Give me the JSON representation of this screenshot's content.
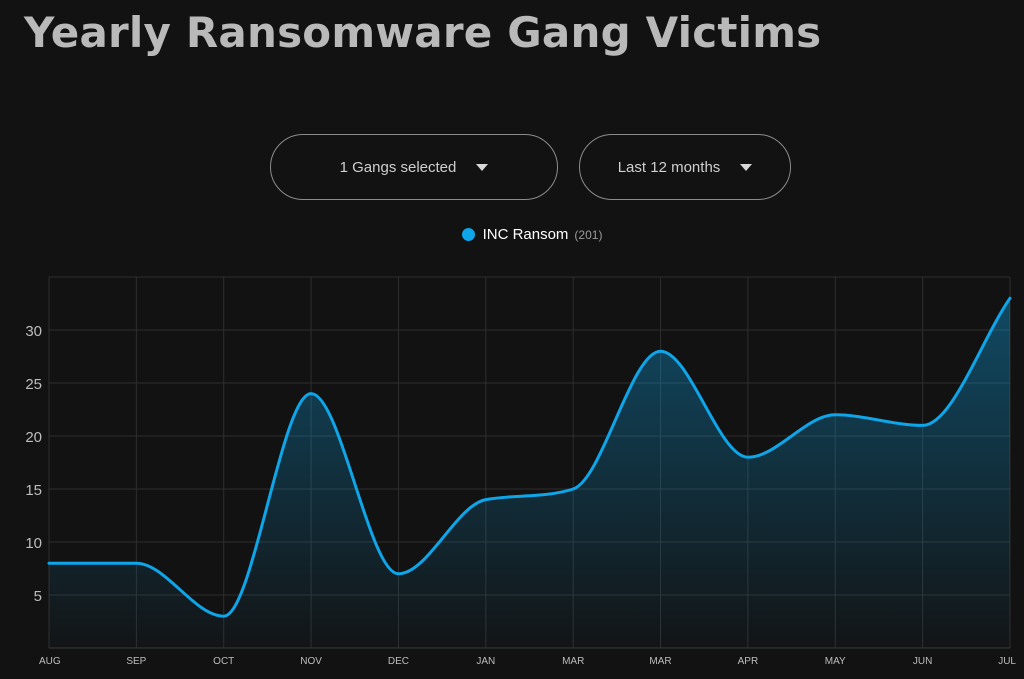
{
  "page": {
    "title": "Yearly Ransomware Gang Victims"
  },
  "filters": {
    "gangs_label": "1 Gangs selected",
    "range_label": "Last 12 months"
  },
  "colors": {
    "series": "#0ea5e9",
    "background": "#121212",
    "grid": "#2e2e2e"
  },
  "chart_data": {
    "type": "area",
    "title": "",
    "xlabel": "",
    "ylabel": "",
    "categories": [
      "AUG",
      "SEP",
      "OCT",
      "NOV",
      "DEC",
      "JAN",
      "MAR",
      "MAR",
      "APR",
      "MAY",
      "JUN",
      "JUL"
    ],
    "series": [
      {
        "name": "INC Ransom",
        "total_label": "(201)",
        "values": [
          8,
          8,
          3,
          24,
          7,
          14,
          15,
          28,
          18,
          22,
          21,
          33
        ]
      }
    ],
    "ylim": [
      0,
      35
    ],
    "yticks": [
      5,
      10,
      15,
      20,
      25,
      30
    ],
    "grid": true,
    "legend": "top-center"
  }
}
